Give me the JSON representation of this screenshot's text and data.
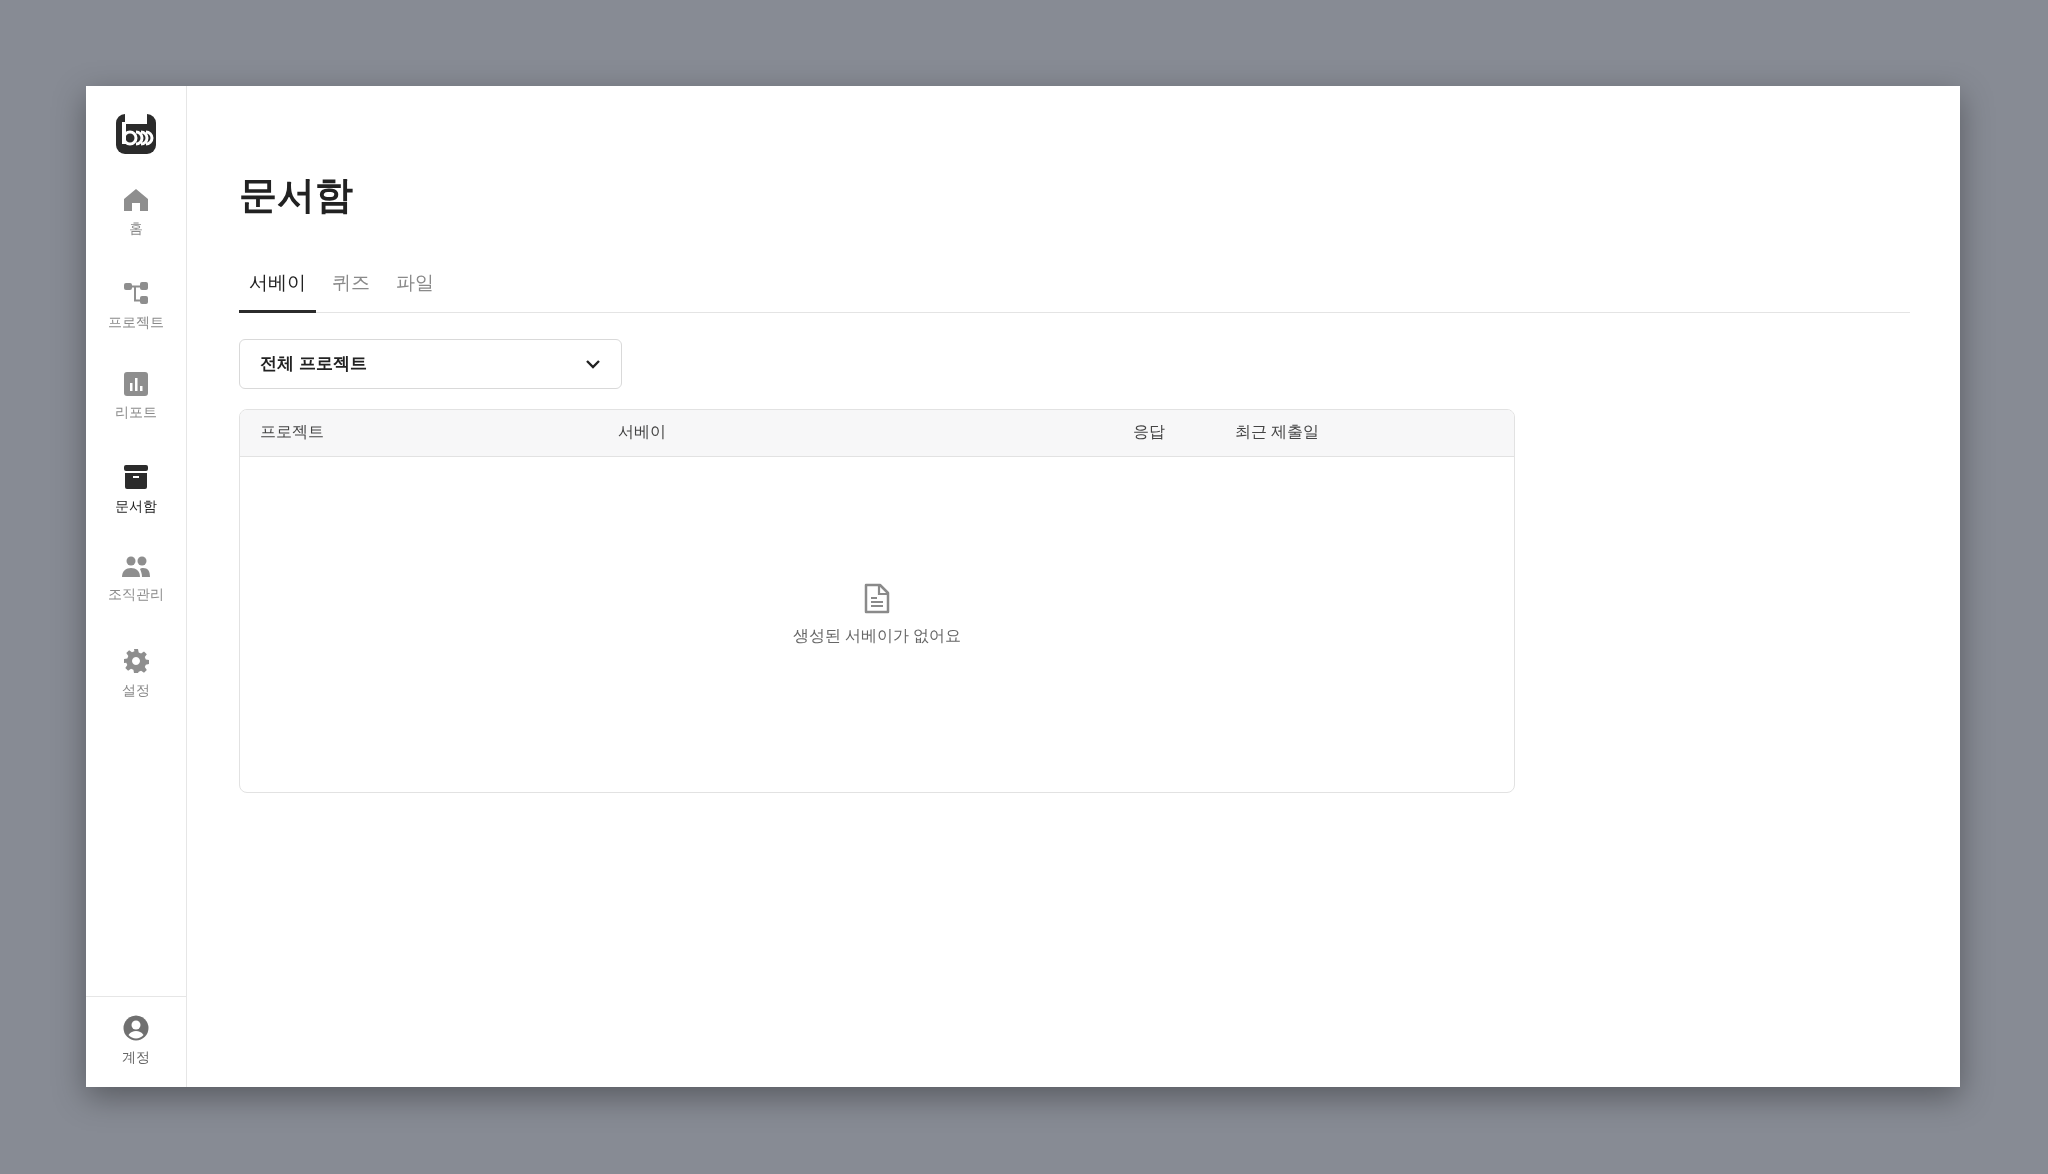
{
  "sidebar": {
    "items": [
      {
        "label": "홈",
        "selected": false
      },
      {
        "label": "프로젝트",
        "selected": false
      },
      {
        "label": "리포트",
        "selected": false
      },
      {
        "label": "문서함",
        "selected": true
      },
      {
        "label": "조직관리",
        "selected": false
      },
      {
        "label": "설정",
        "selected": false
      }
    ],
    "account": {
      "label": "계정"
    }
  },
  "page": {
    "title": "문서함"
  },
  "tabs": [
    {
      "label": "서베이",
      "selected": true
    },
    {
      "label": "퀴즈",
      "selected": false
    },
    {
      "label": "파일",
      "selected": false
    }
  ],
  "filter": {
    "value": "전체 프로젝트"
  },
  "table": {
    "columns": [
      "프로젝트",
      "서베이",
      "응답",
      "최근 제출일"
    ],
    "empty_message": "생성된 서베이가 없어요"
  }
}
